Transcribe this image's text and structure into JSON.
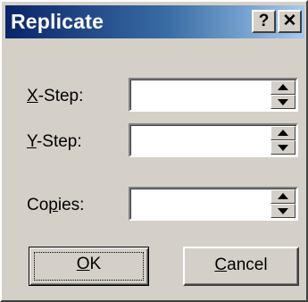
{
  "dialog": {
    "title": "Replicate",
    "help_button": "?",
    "close_button": "✕"
  },
  "fields": [
    {
      "prefix": "",
      "mnemonic": "X",
      "suffix": "-Step:",
      "value": ""
    },
    {
      "prefix": "",
      "mnemonic": "Y",
      "suffix": "-Step:",
      "value": ""
    },
    {
      "prefix": "Co",
      "mnemonic": "p",
      "suffix": "ies:",
      "value": ""
    }
  ],
  "buttons": {
    "ok": {
      "mnemonic": "O",
      "rest": "K"
    },
    "cancel": {
      "mnemonic": "C",
      "rest": "ancel"
    }
  },
  "colors": {
    "face": "#d4d0c8",
    "title_start": "#0a246a",
    "title_end": "#a6caf0"
  }
}
